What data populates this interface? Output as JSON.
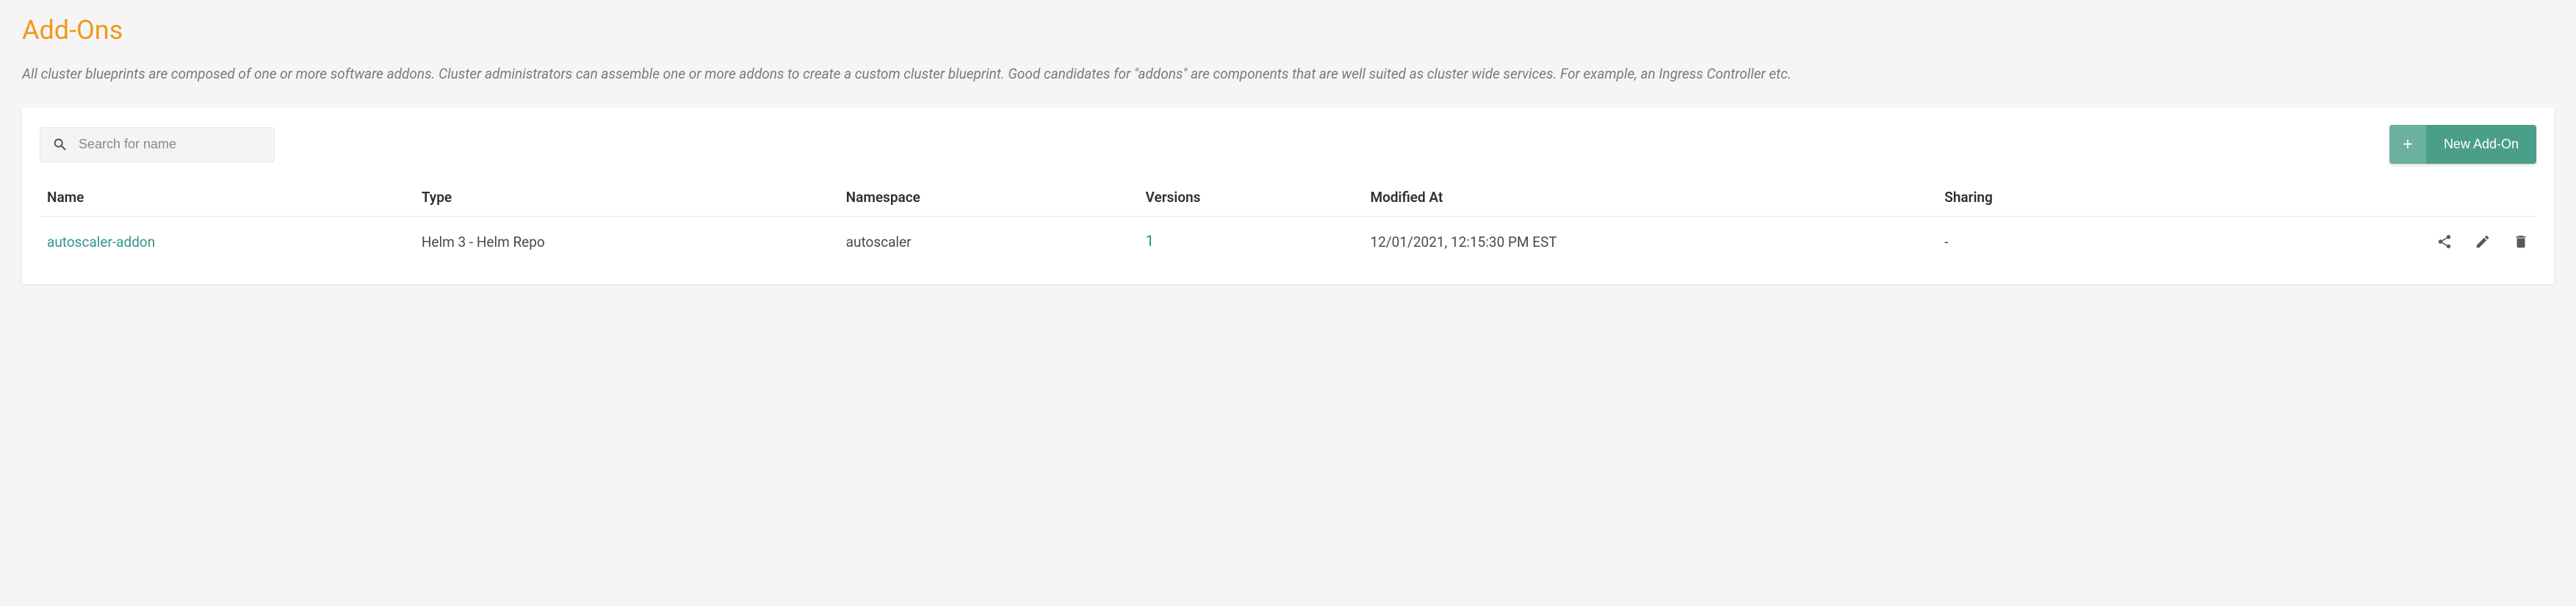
{
  "page": {
    "title": "Add-Ons",
    "description": "All cluster blueprints are composed of one or more software addons. Cluster administrators can assemble one or more addons to create a custom cluster blueprint. Good candidates for \"addons\" are components that are well suited as cluster wide services. For example, an Ingress Controller etc."
  },
  "search": {
    "placeholder": "Search for name"
  },
  "buttons": {
    "new_addon": "New Add-On",
    "plus": "+"
  },
  "table": {
    "headers": {
      "name": "Name",
      "type": "Type",
      "namespace": "Namespace",
      "versions": "Versions",
      "modified_at": "Modified At",
      "sharing": "Sharing"
    },
    "rows": [
      {
        "name": "autoscaler-addon",
        "type": "Helm 3 - Helm Repo",
        "namespace": "autoscaler",
        "versions": "1",
        "modified_at": "12/01/2021, 12:15:30 PM EST",
        "sharing": "-"
      }
    ]
  }
}
